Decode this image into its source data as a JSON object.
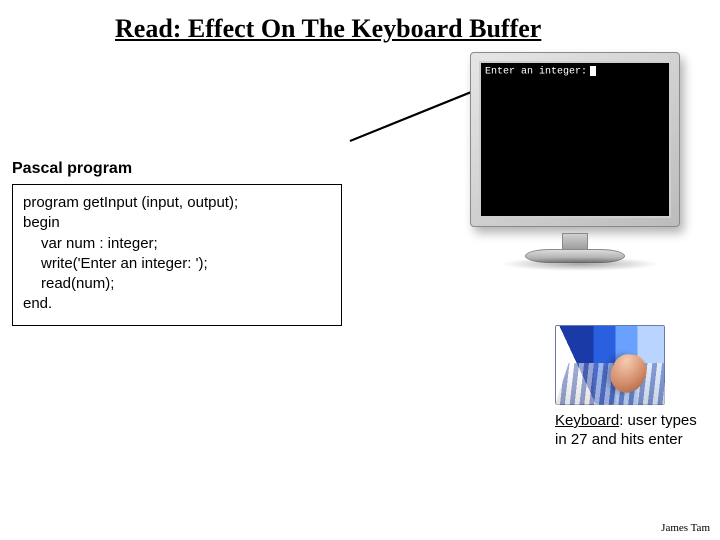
{
  "title": "Read: Effect On The Keyboard Buffer",
  "subtitle": "Pascal program",
  "code": {
    "line1": "program getInput (input, output);",
    "line2": "begin",
    "line3": "var num : integer;",
    "line4": "write('Enter an integer: ');",
    "line5": "read(num);",
    "line6": "end."
  },
  "screen": {
    "prompt": "Enter an integer:"
  },
  "keyboard_caption": {
    "label": "Keyboard",
    "rest": ": user types in 27 and hits enter"
  },
  "footer": "James Tam"
}
